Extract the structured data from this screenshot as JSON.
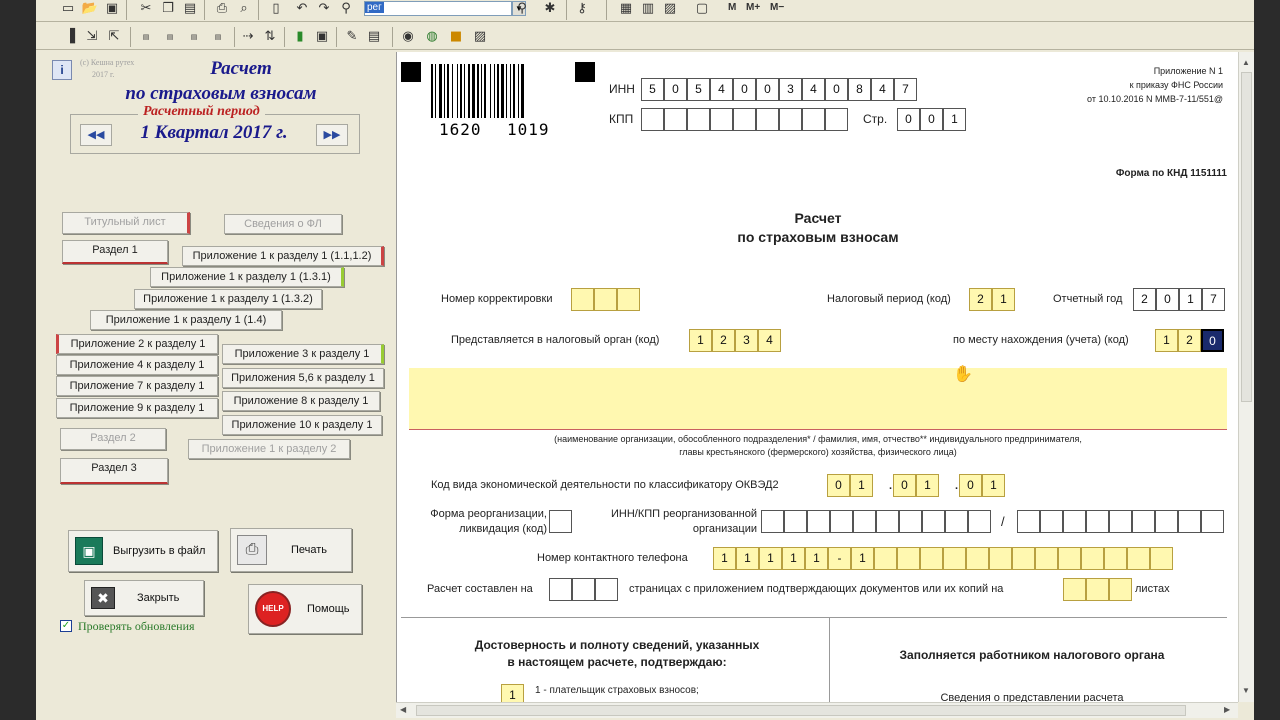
{
  "toolbar": {
    "combo_value": "рег",
    "m_label": "M",
    "mplus_label": "M+",
    "mminus_label": "M−"
  },
  "left": {
    "copyright_line1": "(с) Кешна рутех",
    "copyright_line2": "2017 г.",
    "title_line1": "Расчет",
    "title_line2": "по страховым взносам",
    "period_label": "Расчетный период",
    "period_value": "1 Квартал 2017 г.",
    "nav": {
      "title_page": "Титульный лист",
      "fl_info": "Сведения о ФЛ",
      "section1": "Раздел 1",
      "app1_s1_11_12": "Приложение 1 к разделу 1 (1.1,1.2)",
      "app1_s1_131": "Приложение 1 к разделу 1 (1.3.1)",
      "app1_s1_132": "Приложение 1 к разделу 1 (1.3.2)",
      "app1_s1_14": "Приложение 1 к разделу 1 (1.4)",
      "app2_s1": "Приложение 2 к разделу 1",
      "app3_s1": "Приложение 3 к разделу 1",
      "app4_s1": "Приложение 4 к разделу 1",
      "app56_s1": "Приложения 5,6 к разделу 1",
      "app7_s1": "Приложение 7 к разделу 1",
      "app8_s1": "Приложение 8 к разделу 1",
      "app9_s1": "Приложение 9 к разделу 1",
      "app10_s1": "Приложение 10 к разделу 1",
      "section2": "Раздел 2",
      "app1_s2": "Приложение 1 к разделу 2",
      "section3": "Раздел 3"
    },
    "export_label": "Выгрузить в файл",
    "print_label": "Печать",
    "close_label": "Закрыть",
    "help_label": "Помощь",
    "help_icon_text": "HELP",
    "check_updates_label": "Проверять обновления",
    "check_mark": "✓"
  },
  "doc": {
    "barcode_number_left": "1620",
    "barcode_number_right": "1019",
    "inn_label": "ИНН",
    "inn_digits": [
      "5",
      "0",
      "5",
      "4",
      "0",
      "0",
      "3",
      "4",
      "0",
      "8",
      "4",
      "7"
    ],
    "kpp_label": "КПП",
    "page_label": "Стр.",
    "page_digits": [
      "0",
      "0",
      "1"
    ],
    "header_line1": "Приложение N 1",
    "header_line2": "к приказу ФНС России",
    "header_line3": "от 10.10.2016 N ММВ-7-11/551@",
    "knd": "Форма по КНД 1151111",
    "form_title_line1": "Расчет",
    "form_title_line2": "по страховым взносам",
    "correction_label": "Номер корректировки",
    "tax_period_label": "Налоговый период (код)",
    "tax_period_digits": [
      "2",
      "1"
    ],
    "report_year_label": "Отчетный год",
    "report_year_digits": [
      "2",
      "0",
      "1",
      "7"
    ],
    "tax_organ_label": "Представляется в налоговый орган (код)",
    "tax_organ_digits": [
      "1",
      "2",
      "3",
      "4"
    ],
    "location_label": "по месту нахождения (учета) (код)",
    "location_digits": [
      "1",
      "2",
      "0"
    ],
    "org_caption_line1": "(наименование организации, обособленного подразделения* / фамилия, имя, отчество** индивидуального предпринимателя,",
    "org_caption_line2": "главы крестьянского (фермерского) хозяйства, физического лица)",
    "okved_label": "Код вида экономической деятельности по классификатору ОКВЭД2",
    "okved_digits": [
      "0",
      "1",
      "0",
      "1",
      "0",
      "1"
    ],
    "okved_dot": ".",
    "reorg_form_line1": "Форма реорганизации,",
    "reorg_form_line2": "ликвидация (код)",
    "reorg_inn_line1": "ИНН/КПП реорганизованной",
    "reorg_inn_line2": "организации",
    "slash": "/",
    "phone_label": "Номер контактного телефона",
    "phone_digits": [
      "1",
      "1",
      "1",
      "1",
      "1",
      "-",
      "1"
    ],
    "pages_label": "Расчет составлен на",
    "pages_middle": "страницах с приложением подтверждающих документов или их копий на",
    "sheets_label": "листах",
    "confirm_line1": "Достоверность и полноту сведений, указанных",
    "confirm_line2": "в настоящем расчете, подтверждаю:",
    "confirm_digit": "1",
    "payer_label": "1 - плательщик страховых взносов;",
    "tax_worker_label": "Заполняется работником налогового органа",
    "submission_label": "Сведения о представлении расчета"
  }
}
